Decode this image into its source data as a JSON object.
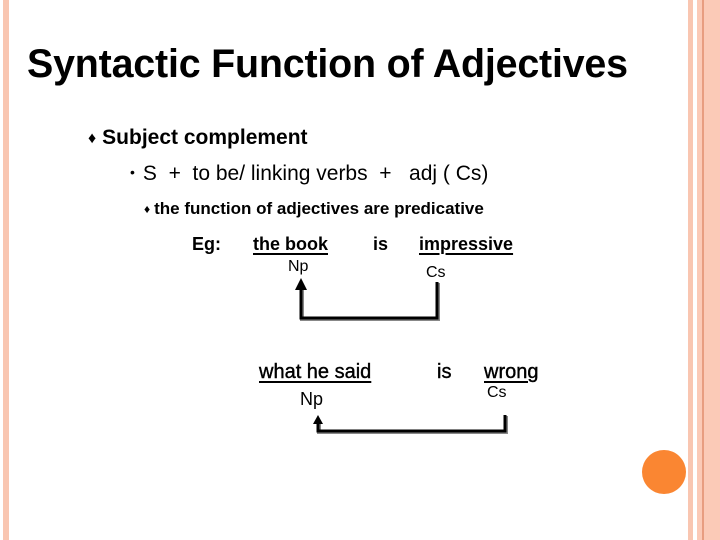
{
  "slide": {
    "title": "Syntactic Function of Adjectives",
    "bullet_l1": {
      "marker": "♦",
      "text": "Subject complement"
    },
    "bullet_l2": {
      "marker": "•",
      "text": "S  +  to be/ linking verbs  +   adj ( Cs)"
    },
    "bullet_l3": {
      "marker": "♦",
      "text": "the function of adjectives are predicative"
    },
    "example1": {
      "label": "Eg:",
      "subject": "the book",
      "verb": "is",
      "complement": "impressive",
      "subject_tag": "Np",
      "complement_tag": "Cs"
    },
    "example2": {
      "subject": "what he said",
      "verb": "is",
      "complement": "wrong",
      "subject_tag": "Np",
      "complement_tag": "Cs"
    }
  },
  "theme": {
    "accent_border": "#f9c6b1",
    "accent_dot": "#fa8632"
  }
}
